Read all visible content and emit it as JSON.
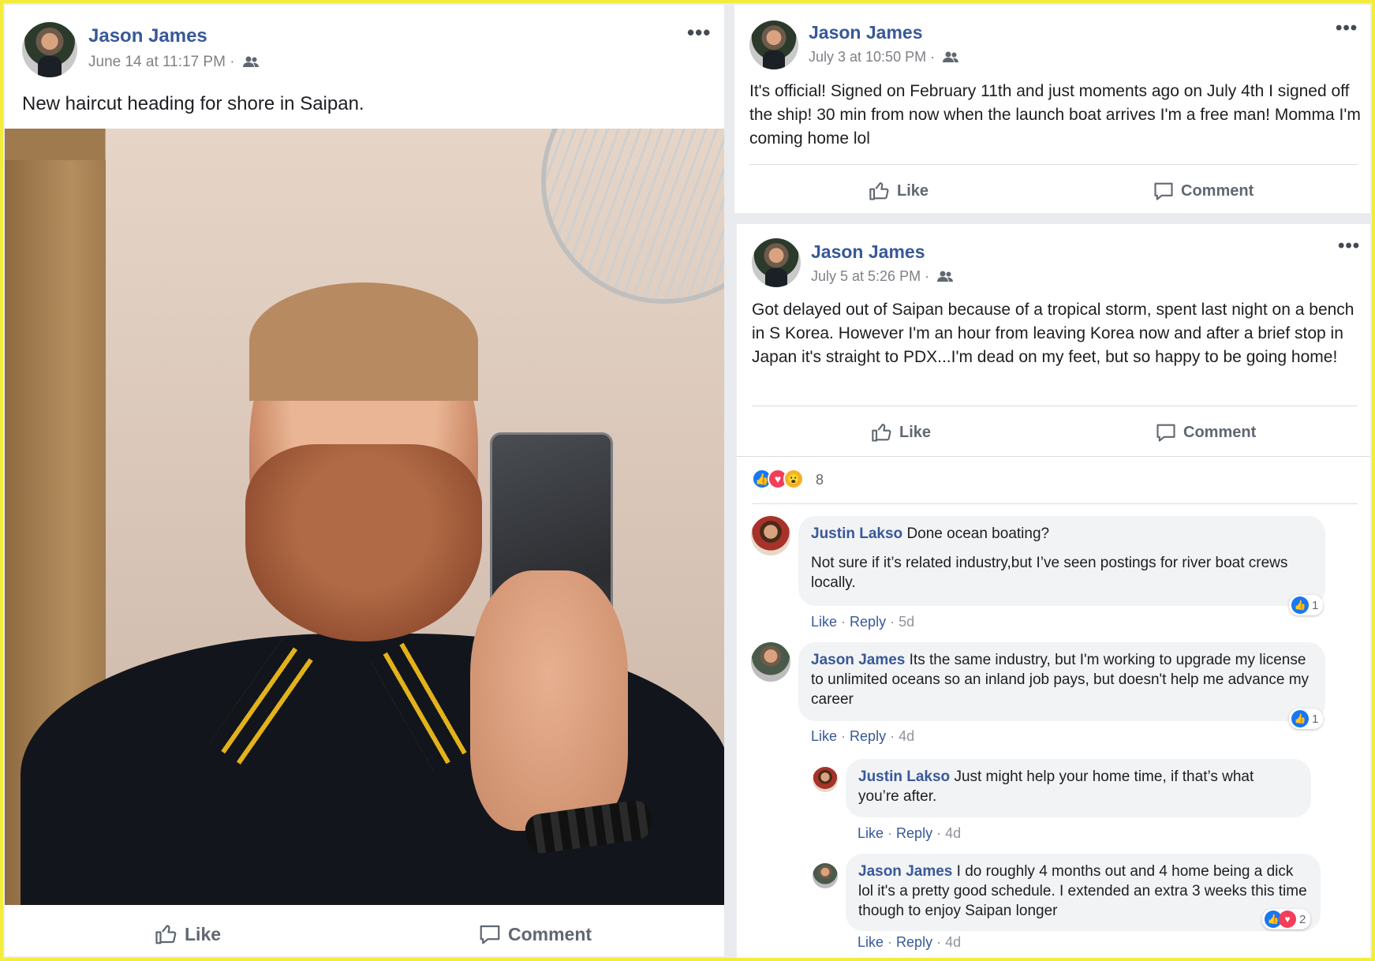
{
  "posts": [
    {
      "author": "Jason James",
      "timestamp": "June 14 at 11:17 PM ·",
      "text": "New haircut heading for shore in Saipan.",
      "like_label": "Like",
      "comment_label": "Comment"
    },
    {
      "author": "Jason James",
      "timestamp": "July 3 at 10:50 PM ·",
      "text": "It's official! Signed on February 11th and just moments ago on July 4th I signed off the ship! 30 min from now when the launch boat arrives I'm a free man! Momma I'm coming home lol",
      "like_label": "Like",
      "comment_label": "Comment"
    },
    {
      "author": "Jason James",
      "timestamp": "July 5 at 5:26 PM ·",
      "text": "Got delayed out of Saipan because of a tropical storm, spent last night on a bench in S Korea. However I'm an hour from leaving Korea now and after a brief stop in Japan it's straight to PDX...I'm dead on my feet, but so happy to be going home!",
      "like_label": "Like",
      "comment_label": "Comment",
      "reaction_count": "8",
      "comments": [
        {
          "author": "Justin Lakso",
          "text1": "Done ocean boating?",
          "text2": "Not sure if it’s related industry,but I’ve seen postings for river boat crews locally.",
          "like": "Like",
          "reply": "Reply",
          "time": "5d",
          "reactions": "1"
        },
        {
          "author": "Jason James",
          "text": "Its the same industry, but I'm working to upgrade my license to unlimited oceans so an inland job pays, but doesn't help me advance my career",
          "like": "Like",
          "reply": "Reply",
          "time": "4d",
          "reactions": "1"
        },
        {
          "author": "Justin Lakso",
          "text": "Just might help your home time, if that’s what you’re after.",
          "like": "Like",
          "reply": "Reply",
          "time": "4d"
        },
        {
          "author": "Jason James",
          "text": "I do roughly 4 months out and 4 home being a dick lol it's a pretty good schedule. I extended an extra 3 weeks this time though to enjoy Saipan longer",
          "like": "Like",
          "reply": "Reply",
          "time": "4d",
          "reactions": "2"
        }
      ]
    }
  ],
  "icons": {
    "more": "more-options-icon",
    "audience": "friends-audience-icon",
    "like": "thumbs-up-icon",
    "comment": "speech-bubble-icon"
  },
  "colors": {
    "name_blue": "#385898",
    "like_blue": "#1877f2",
    "love_red": "#f33e58",
    "wow_yellow": "#f7b125",
    "highlight_border": "#f3ec3c"
  }
}
